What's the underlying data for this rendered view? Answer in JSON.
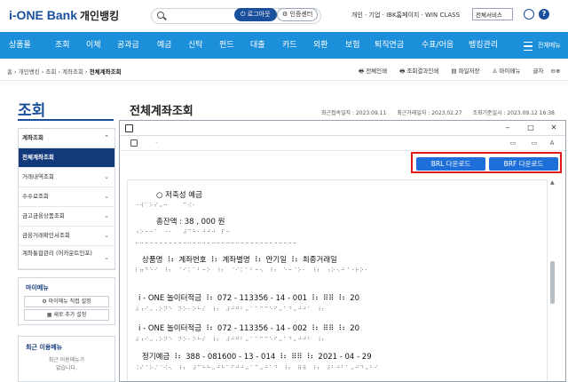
{
  "header": {
    "logo": "i-ONE Bank",
    "logo_sub": "개인뱅킹",
    "login": "로그아웃",
    "cert": "인증센터",
    "links": "개인 · 기업 · IBK홈페이지 · WIN CLASS",
    "select": "전체서비스"
  },
  "gnb": {
    "items": [
      "상품몰",
      "조회",
      "이체",
      "공과금",
      "예금",
      "신탁",
      "펀드",
      "대출",
      "카드",
      "외환",
      "보험",
      "퇴직연금",
      "수표/어음",
      "뱅킹관리"
    ],
    "all_label": "전체메뉴"
  },
  "breadcrumb": {
    "path": "홈 › 개인뱅킹 › 조회 › 계좌조회 › ",
    "current": "전체계좌조회",
    "tools": [
      "전체인쇄",
      "조회결과인쇄",
      "파일저장",
      "마이메뉴",
      "글자"
    ]
  },
  "lnb": {
    "title": "조회",
    "items": [
      {
        "label": "계좌조회",
        "state": "open",
        "chev": "⌃"
      },
      {
        "label": "전체계좌조회",
        "state": "sel",
        "chev": ""
      },
      {
        "label": "거래내역조회",
        "state": "",
        "chev": "⌄"
      },
      {
        "label": "수수료조회",
        "state": "",
        "chev": "⌄"
      },
      {
        "label": "금고금융상품조회",
        "state": "",
        "chev": "⌄"
      },
      {
        "label": "금융거래확인서조회",
        "state": "",
        "chev": "⌄"
      },
      {
        "label": "계좌통합관리 (어카운트인포)",
        "state": "tall",
        "chev": "⌄"
      }
    ]
  },
  "mymenu": {
    "title": "마이메뉴",
    "btn1": "마이메뉴 직접 설정",
    "btn2": "새로 추가 설정"
  },
  "recent": {
    "title": "최근 이용메뉴",
    "msg1": "최근 이용메뉴가",
    "msg2": "없습니다."
  },
  "page": {
    "title": "전체계좌조회",
    "dates": [
      "최근접속일자 : 2023.09.11",
      "최근거래일자 : 2023.02.27",
      "조회기준일시 : 2023.09.12 16:38"
    ]
  },
  "viewer": {
    "window_buttons": [
      "‒",
      "□",
      "✕"
    ],
    "dot": "·",
    "tools": [
      "▭",
      "▭",
      "A"
    ],
    "brl_label": "BRL 다운로드",
    "brf_label": "BRF 다운로드",
    "scroll_up": "▲",
    "lines": [
      {
        "kind": "txt",
        "text": "○  저축성      예금"
      },
      {
        "kind": "br",
        "text": "⠐⠺⠁⠕⠎⠤⠒⠀⠀⠀⠉⠪⠂"
      },
      {
        "kind": "txt",
        "text": "총잔액   :    38  , 000 원"
      },
      {
        "kind": "br",
        "text": "⠰⠕⠒⠒⠁⠀⠐⠂⠀⠀⠼⠉⠓⠂⠚⠚⠚⠀⠏⠒"
      },
      {
        "kind": "br",
        "text": "⠒⠒⠒⠒⠒⠒⠒⠒⠒⠒⠒⠒⠒⠒⠒⠒⠒⠒⠒⠒⠒⠒⠒⠒⠒⠒⠒⠒⠒⠒⠒⠒⠒⠒"
      },
      {
        "kind": "txt",
        "text": "상품명       ⠸⠆  계좌번호      ⠸⠆  계좌별명      ⠸⠆  만기일      ⠸⠆  최종거래일"
      },
      {
        "kind": "br",
        "text": "⠇⠶⠙⠑⠊⠀⠸⠆⠀⠈⠊⠅⠁⠃⠒⠕⠀⠸⠆⠀⠈⠊⠅⠁⠃⠒⠢⠀⠸⠆⠀⠑⠒⠈⠕⠂⠀⠸⠆⠀⠰⠕⠢⠚⠈⠐⠗⠕⠂"
      },
      {
        "kind": "txt",
        "text": "  i - ONE      놀이터적금          ⠸⠆  072   - 113356   - 14 - 001    ⠸⠆  ⠿⠿  ⠸⠆  20"
      },
      {
        "kind": "br",
        "text": "⠼⠰⠊⠤⠠⠕⠝⠑⠀⠝⠕⠂⠕⠓⠎⠀⠸⠆⠀⠼⠚⠛⠃⠤⠁⠁⠉⠉⠑⠋⠤⠁⠙⠤⠚⠚⠁⠀⠸⠆"
      },
      {
        "kind": "txt",
        "text": "  i - ONE      놀이터적금          ⠸⠆  072   - 113356   - 14 - 002    ⠸⠆  ⠿⠿  ⠸⠆  20"
      },
      {
        "kind": "br",
        "text": "⠼⠰⠊⠤⠠⠕⠝⠑⠀⠝⠕⠂⠕⠓⠎⠀⠸⠆⠀⠼⠚⠛⠃⠤⠁⠁⠉⠉⠑⠋⠤⠁⠙⠤⠚⠚⠃⠀⠸⠆"
      },
      {
        "kind": "txt",
        "text": "정기예금         ⠸⠆  388   - 081600   - 13 - 014    ⠸⠆  ⠿⠿  ⠸⠆  2021    - 04 - 29"
      },
      {
        "kind": "br",
        "text": "⠨⠎⠈⠕⠌⠈⠪⠢⠀⠸⠆⠀⠼⠉⠓⠓⠤⠚⠓⠁⠋⠚⠚⠤⠁⠉⠤⠚⠁⠙⠀⠸⠆⠀⠿⠿⠀⠸⠆⠀⠼⠃⠚⠃⠁⠤⠚⠙⠤⠃⠊"
      }
    ]
  }
}
